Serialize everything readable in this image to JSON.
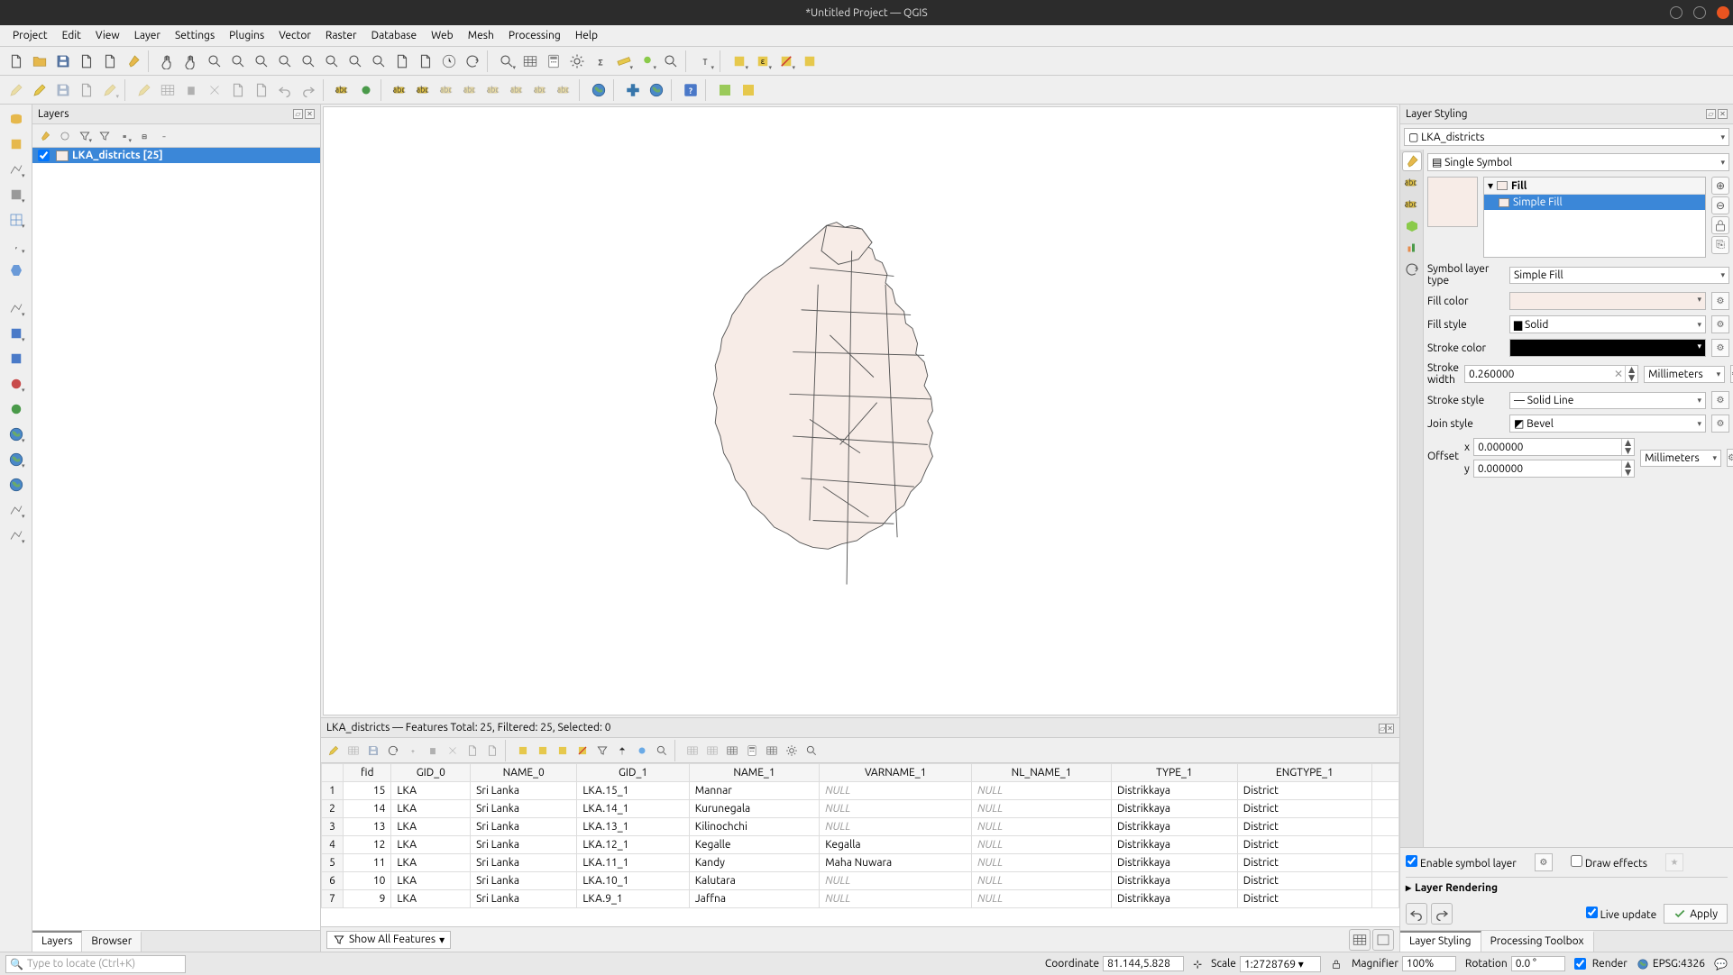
{
  "window_title": "*Untitled Project — QGIS",
  "menu": [
    "Project",
    "Edit",
    "View",
    "Layer",
    "Settings",
    "Plugins",
    "Vector",
    "Raster",
    "Database",
    "Web",
    "Mesh",
    "Processing",
    "Help"
  ],
  "layers_panel": {
    "title": "Layers",
    "item_name": "LKA_districts [25]"
  },
  "attr": {
    "title": "LKA_districts — Features Total: 25, Filtered: 25, Selected: 0",
    "columns": [
      "fid",
      "GID_0",
      "NAME_0",
      "GID_1",
      "NAME_1",
      "VARNAME_1",
      "NL_NAME_1",
      "TYPE_1",
      "ENGTYPE_1"
    ],
    "rows": [
      {
        "n": 1,
        "fid": 15,
        "gid0": "LKA",
        "name0": "Sri Lanka",
        "gid1": "LKA.15_1",
        "name1": "Mannar",
        "var": "NULL",
        "nl": "NULL",
        "type": "Distrikkaya",
        "eng": "District"
      },
      {
        "n": 2,
        "fid": 14,
        "gid0": "LKA",
        "name0": "Sri Lanka",
        "gid1": "LKA.14_1",
        "name1": "Kurunegala",
        "var": "NULL",
        "nl": "NULL",
        "type": "Distrikkaya",
        "eng": "District"
      },
      {
        "n": 3,
        "fid": 13,
        "gid0": "LKA",
        "name0": "Sri Lanka",
        "gid1": "LKA.13_1",
        "name1": "Kilinochchi",
        "var": "NULL",
        "nl": "NULL",
        "type": "Distrikkaya",
        "eng": "District"
      },
      {
        "n": 4,
        "fid": 12,
        "gid0": "LKA",
        "name0": "Sri Lanka",
        "gid1": "LKA.12_1",
        "name1": "Kegalle",
        "var": "Kegalla",
        "nl": "NULL",
        "type": "Distrikkaya",
        "eng": "District"
      },
      {
        "n": 5,
        "fid": 11,
        "gid0": "LKA",
        "name0": "Sri Lanka",
        "gid1": "LKA.11_1",
        "name1": "Kandy",
        "var": "Maha Nuwara",
        "nl": "NULL",
        "type": "Distrikkaya",
        "eng": "District"
      },
      {
        "n": 6,
        "fid": 10,
        "gid0": "LKA",
        "name0": "Sri Lanka",
        "gid1": "LKA.10_1",
        "name1": "Kalutara",
        "var": "NULL",
        "nl": "NULL",
        "type": "Distrikkaya",
        "eng": "District"
      },
      {
        "n": 7,
        "fid": 9,
        "gid0": "LKA",
        "name0": "Sri Lanka",
        "gid1": "LKA.9_1",
        "name1": "Jaffna",
        "var": "NULL",
        "nl": "NULL",
        "type": "Distrikkaya",
        "eng": "District"
      }
    ],
    "show_all": "Show All Features"
  },
  "styling": {
    "title": "Layer Styling",
    "layer_combo": "LKA_districts",
    "renderer": "Single Symbol",
    "tree_hdr": "Fill",
    "tree_row": "Simple Fill",
    "slt_label": "Symbol layer type",
    "slt_value": "Simple Fill",
    "fill_color": "Fill color",
    "fill_style": "Fill style",
    "fill_style_value": "Solid",
    "stroke_color": "Stroke color",
    "stroke_width": "Stroke width",
    "stroke_width_value": "0.260000",
    "stroke_width_unit": "Millimeters",
    "stroke_style": "Stroke style",
    "stroke_style_value": "Solid Line",
    "join_style": "Join style",
    "join_style_value": "Bevel",
    "offset": "Offset",
    "off_x": "x",
    "off_y": "y",
    "off_x_val": "0.000000",
    "off_y_val": "0.000000",
    "off_unit": "Millimeters",
    "enable_sym": "Enable symbol layer",
    "draw_fx": "Draw effects",
    "rendering": "Layer Rendering",
    "live": "Live update",
    "apply": "Apply"
  },
  "bottom_tabs_left": [
    "Layers",
    "Browser"
  ],
  "bottom_tabs_right": [
    "Layer Styling",
    "Processing Toolbox"
  ],
  "status": {
    "locator_ph": "Type to locate (Ctrl+K)",
    "coord_lbl": "Coordinate",
    "coord_val": "81.144,5.828",
    "scale_lbl": "Scale",
    "scale_val": "1:2728769",
    "mag_lbl": "Magnifier",
    "mag_val": "100%",
    "rot_lbl": "Rotation",
    "rot_val": "0.0 °",
    "render": "Render",
    "crs": "EPSG:4326"
  }
}
